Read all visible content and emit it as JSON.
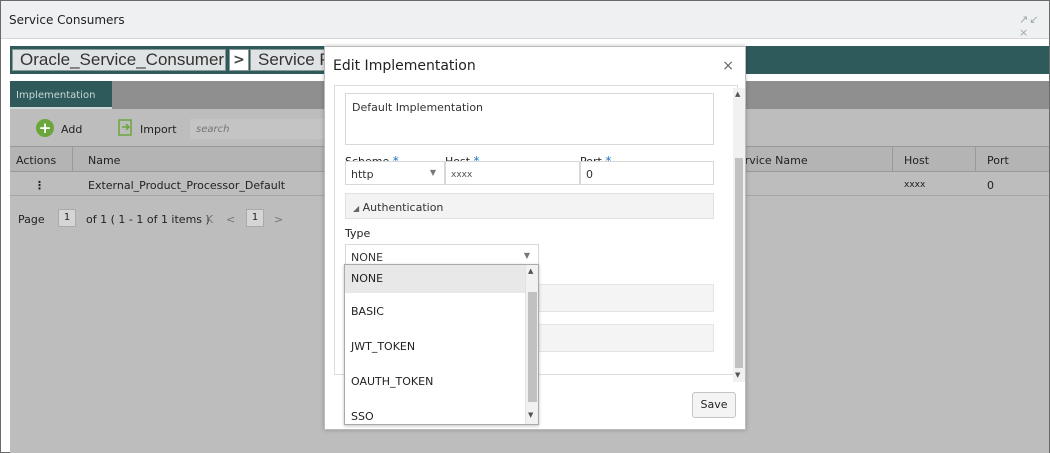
{
  "window": {
    "title": "Service Consumers",
    "controls": "↗↙ ×"
  },
  "breadcrumb": {
    "items": [
      "Oracle_Service_Consumer",
      "Service Pro"
    ],
    "separator": ">"
  },
  "tabs": [
    {
      "label": "Implementation"
    }
  ],
  "toolbar": {
    "add_label": "Add",
    "import_label": "Import",
    "search_placeholder": "search"
  },
  "grid": {
    "columns": [
      "Actions",
      "Name",
      "ervice Name",
      "Host",
      "Port"
    ],
    "rows": [
      {
        "actions": "⋮",
        "name": "External_Product_Processor_Default",
        "service_name": "",
        "host": "xxxx",
        "port": "0"
      }
    ]
  },
  "pager": {
    "page_label": "Page",
    "page": "1",
    "of_text": "of 1  ( 1 - 1 of 1 items )",
    "first": "K",
    "prev": "<",
    "current": "1",
    "next": ">"
  },
  "modal": {
    "title": "Edit Implementation",
    "close": "×",
    "description_value": "Default Implementation",
    "scheme": {
      "label": "Scheme",
      "value": "http"
    },
    "host": {
      "label": "Host",
      "value": "xxxx"
    },
    "port": {
      "label": "Port",
      "value": "0"
    },
    "required_mark": "*",
    "auth_section": "Authentication",
    "auth_toggle": "◢",
    "type": {
      "label": "Type",
      "value": "NONE"
    },
    "save_label": "Save"
  },
  "dropdown": {
    "options": [
      "NONE",
      "BASIC",
      "JWT_TOKEN",
      "OAUTH_TOKEN",
      "SSO"
    ],
    "selected": "NONE"
  },
  "icons": {
    "add": "plus-circle-icon",
    "import": "import-icon",
    "close": "close-icon",
    "caret": "chevron-down-icon"
  },
  "colors": {
    "accent": "#2e5a5c",
    "add_green": "#6aa63b",
    "required": "#1e73c8"
  }
}
